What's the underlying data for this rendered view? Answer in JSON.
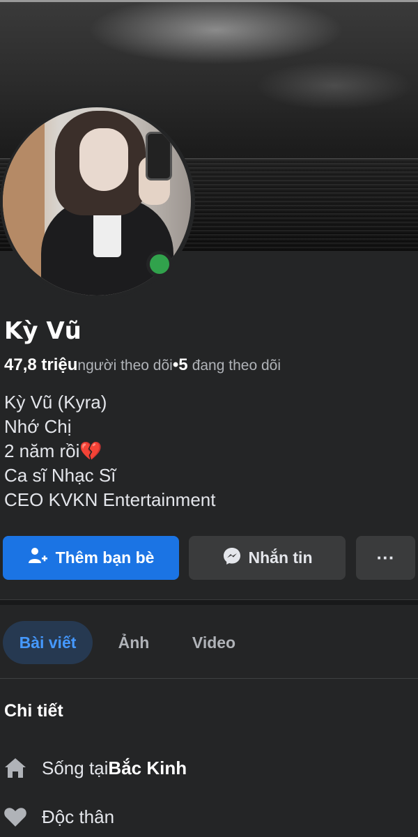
{
  "profile": {
    "name": "Kỳ Vũ",
    "followers_count": "47,8 triệu",
    "followers_label": "người theo dõi",
    "separator": "•",
    "following_count": "5",
    "following_label": "đang theo dõi",
    "online": true
  },
  "bio": {
    "lines": [
      "Kỳ Vũ (Kyra)",
      "Nhớ Chị",
      "2 năm rồi💔",
      "Ca sĩ Nhạc Sĩ",
      "CEO KVKN Entertainment"
    ]
  },
  "actions": {
    "add_friend_label": "Thêm bạn bè",
    "message_label": "Nhắn tin",
    "more_label": "···"
  },
  "tabs": [
    {
      "label": "Bài viết",
      "active": true
    },
    {
      "label": "Ảnh",
      "active": false
    },
    {
      "label": "Video",
      "active": false
    }
  ],
  "details": {
    "title": "Chi tiết",
    "lives_prefix": "Sống tại ",
    "lives_city": "Bắc Kinh",
    "relationship": "Độc thân"
  },
  "colors": {
    "background": "#242526",
    "primary_button": "#1b74e4",
    "secondary_button": "#3a3b3c",
    "active_tab_bg": "#263951",
    "active_tab_text": "#4599ff",
    "online_dot": "#31a24c"
  },
  "icons": {
    "add_friend": "person-plus-icon",
    "messenger": "messenger-icon",
    "more": "more-horizontal-icon",
    "home": "home-icon",
    "heart": "heart-icon"
  }
}
